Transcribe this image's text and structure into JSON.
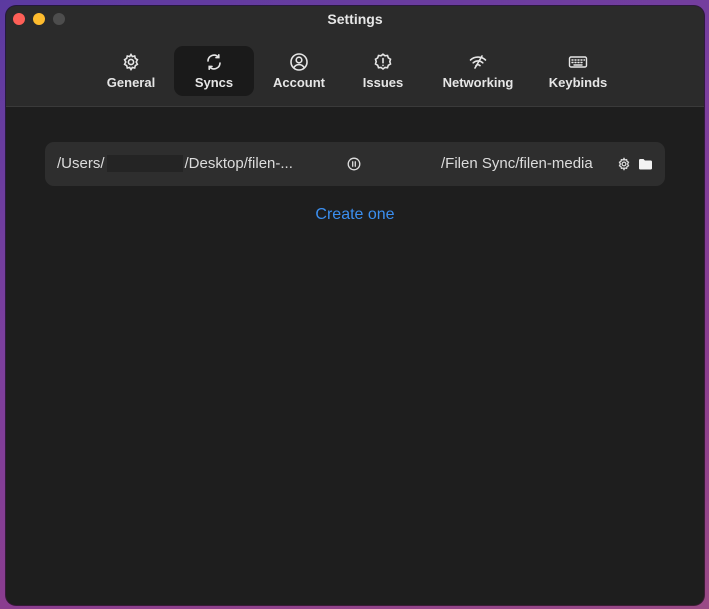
{
  "window": {
    "title": "Settings"
  },
  "tabs": [
    {
      "label": "General",
      "icon": "gear-icon"
    },
    {
      "label": "Syncs",
      "icon": "sync-icon",
      "active": true
    },
    {
      "label": "Account",
      "icon": "user-circle-icon"
    },
    {
      "label": "Issues",
      "icon": "alert-badge-icon"
    },
    {
      "label": "Networking",
      "icon": "wifi-icon"
    },
    {
      "label": "Keybinds",
      "icon": "keyboard-icon"
    }
  ],
  "sync": {
    "local_prefix": "/Users/",
    "local_suffix": "/Desktop/filen-...",
    "remote_path": "/Filen Sync/filen-media"
  },
  "create_link": "Create one",
  "colors": {
    "accent": "#3b8ff0",
    "window_bg": "#1e1e1e",
    "titlebar_bg": "#2b2b2b",
    "row_bg": "#2e2e2e",
    "close": "#fe5f57",
    "minimize": "#febc2e",
    "maximize": "#4d4d4d"
  }
}
